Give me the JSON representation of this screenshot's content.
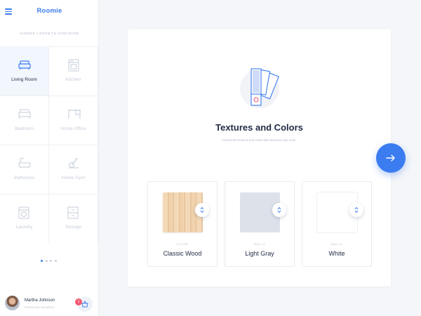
{
  "app": {
    "brand": "Roomie"
  },
  "sidebar": {
    "section_label": "CHOOSE A ROOM TO CONFIGURE",
    "rooms": [
      {
        "label": "Living Room",
        "icon": "sofa-icon",
        "active": true
      },
      {
        "label": "Kitchen",
        "icon": "stove-icon",
        "active": false
      },
      {
        "label": "Bedroom",
        "icon": "bed-icon",
        "active": false
      },
      {
        "label": "Home Office",
        "icon": "desk-icon",
        "active": false
      },
      {
        "label": "Bathroom",
        "icon": "bathtub-icon",
        "active": false
      },
      {
        "label": "Home Gym",
        "icon": "exercise-bike-icon",
        "active": false
      },
      {
        "label": "Laundry",
        "icon": "washing-machine-icon",
        "active": false
      },
      {
        "label": "Storage",
        "icon": "cabinet-icon",
        "active": false
      }
    ],
    "pager": {
      "pages": 4,
      "current": 1
    }
  },
  "user": {
    "name": "Martha Johnson",
    "tier": "PREMIUM MEMBER",
    "cart_count": "1"
  },
  "main": {
    "title": "Textures and Colors",
    "subtitle": "Choose the textures and colors that represent your room.",
    "materials": [
      {
        "category": "FLOOR",
        "name": "Classic Wood",
        "swatch": "wood"
      },
      {
        "category": "WALLS",
        "name": "Light Gray",
        "swatch": "#dde2ea"
      },
      {
        "category": "WALLS",
        "name": "White",
        "swatch": "#ffffff"
      }
    ]
  },
  "colors": {
    "accent": "#3b7cf0",
    "badge": "#f05b72",
    "text": "#1f2a44",
    "muted": "#c6cdd8"
  }
}
